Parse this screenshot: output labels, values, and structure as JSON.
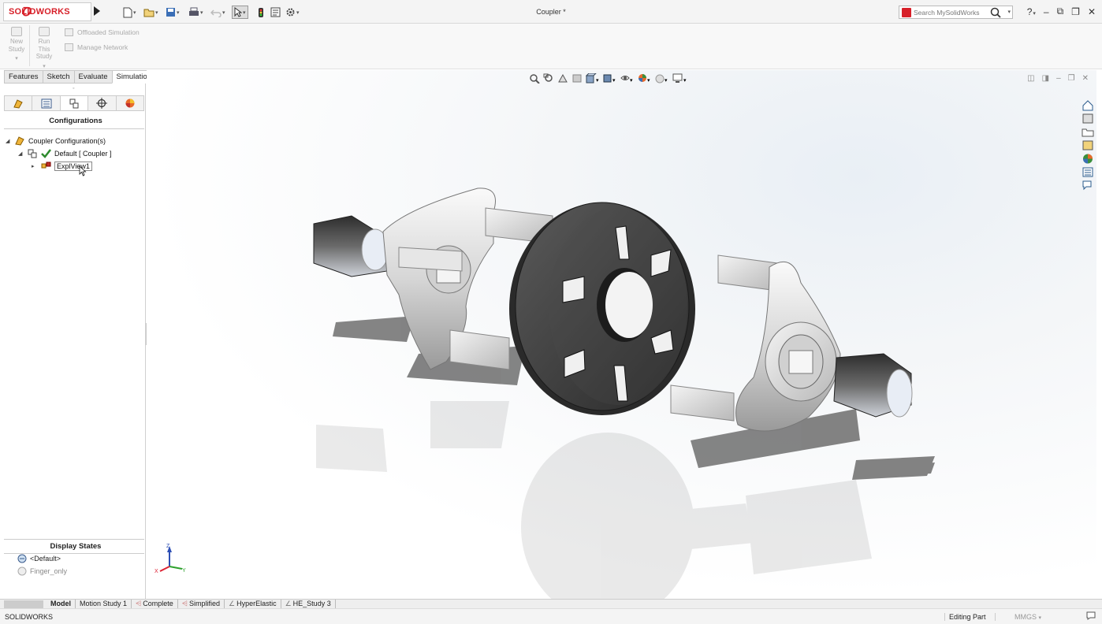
{
  "app": {
    "logo": "SOLIDWORKS",
    "title": "Coupler *"
  },
  "search": {
    "placeholder": "Search MySolidWorks"
  },
  "ribbon": {
    "new_study": "New Study",
    "run_study": "Run This Study",
    "offloaded": "Offloaded Simulation",
    "manage_network": "Manage Network"
  },
  "tabs": [
    "Features",
    "Sketch",
    "Evaluate",
    "Simulation"
  ],
  "panel": {
    "title": "Configurations",
    "tree": {
      "root": "Coupler Configuration(s)",
      "default": "Default [ Coupler ]",
      "explview": "ExplView1"
    },
    "display_states_title": "Display States",
    "display_states": [
      "<Default>",
      "Finger_only"
    ]
  },
  "bottom_tabs": [
    "Model",
    "Motion Study 1",
    "Complete",
    "Simplified",
    "HyperElastic",
    "HE_Study 3"
  ],
  "status": {
    "left": "SOLIDWORKS",
    "editing": "Editing Part",
    "units": "MMGS"
  },
  "colors": {
    "brand": "#d71f28",
    "check": "#2e8b2e",
    "rubber": "#3a3a3a",
    "metal": "#e3e3e3"
  },
  "triad": {
    "z": "Z",
    "y": "Y",
    "x": "X"
  }
}
